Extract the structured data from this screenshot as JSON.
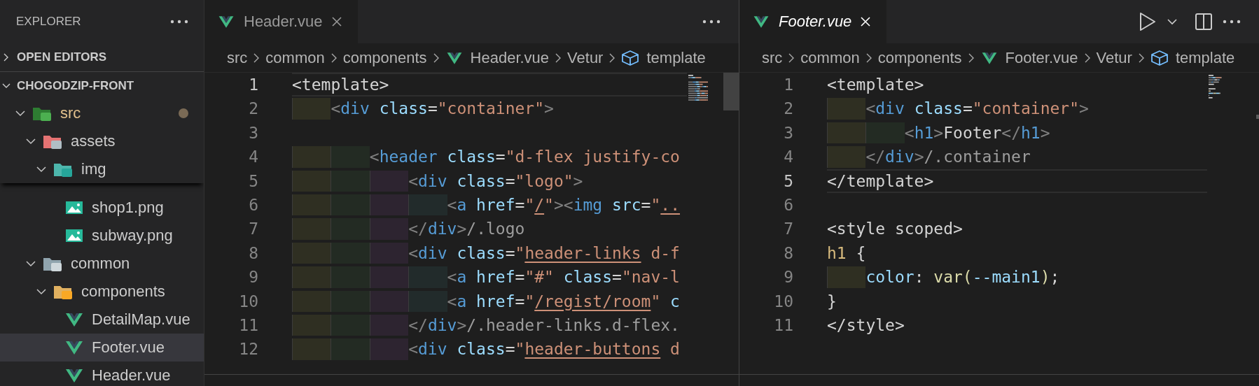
{
  "explorer": {
    "title": "EXPLORER",
    "sections": [
      {
        "label": "OPEN EDITORS",
        "expanded": false
      },
      {
        "label": "CHOGODZIP-FRONT",
        "expanded": true,
        "tree": [
          {
            "label": "src",
            "kind": "folder-code",
            "expanded": true,
            "modified": true,
            "children": [
              {
                "label": "assets",
                "kind": "folder-gear",
                "expanded": true,
                "modified": false,
                "children": [
                  {
                    "label": "img",
                    "kind": "folder-image",
                    "expanded": true,
                    "modified": false,
                    "children": [
                      {
                        "label": "shop1.png",
                        "kind": "image",
                        "selected": false,
                        "modified": false
                      },
                      {
                        "label": "subway.png",
                        "kind": "image",
                        "selected": false,
                        "modified": false
                      }
                    ]
                  }
                ]
              },
              {
                "label": "common",
                "kind": "folder-common",
                "expanded": true,
                "modified": false,
                "children": [
                  {
                    "label": "components",
                    "kind": "folder-lego",
                    "expanded": true,
                    "modified": false,
                    "children": [
                      {
                        "label": "DetailMap.vue",
                        "kind": "vue",
                        "selected": false,
                        "modified": false
                      },
                      {
                        "label": "Footer.vue",
                        "kind": "vue",
                        "selected": true,
                        "modified": false
                      },
                      {
                        "label": "Header.vue",
                        "kind": "vue",
                        "selected": false,
                        "modified": false
                      }
                    ]
                  }
                ]
              }
            ]
          }
        ]
      }
    ]
  },
  "editors": [
    {
      "focused": false,
      "tabs": [
        {
          "label": "Header.vue",
          "kind": "vue",
          "selected": true,
          "preview": false
        }
      ],
      "actions": [
        {
          "kind": "more"
        }
      ],
      "breadcrumbs": [
        {
          "kind": "plain",
          "label": "src"
        },
        {
          "kind": "plain",
          "label": "common"
        },
        {
          "kind": "plain",
          "label": "components"
        },
        {
          "kind": "vue",
          "label": "Header.vue"
        },
        {
          "kind": "plain",
          "label": "Vetur"
        },
        {
          "kind": "cube",
          "label": "template"
        }
      ],
      "lines": [
        {
          "n": "1",
          "current": true,
          "tokens": [
            {
              "kind": "text",
              "text": "<template>"
            }
          ]
        },
        {
          "n": "2",
          "current": false,
          "tokens": [
            {
              "kind": "punct",
              "text": "    <"
            },
            {
              "kind": "tag",
              "text": "div"
            },
            {
              "kind": "attr",
              "text": " class"
            },
            {
              "kind": "text",
              "text": "="
            },
            {
              "kind": "string",
              "text": "\"container\""
            },
            {
              "kind": "punct",
              "text": ">"
            }
          ]
        },
        {
          "n": "3",
          "current": false
        },
        {
          "n": "4",
          "current": false,
          "tokens": [
            {
              "kind": "punct",
              "text": "        <"
            },
            {
              "kind": "tag",
              "text": "header"
            },
            {
              "kind": "attr",
              "text": " class"
            },
            {
              "kind": "text",
              "text": "="
            },
            {
              "kind": "string",
              "text": "\"d-flex justify-co"
            }
          ]
        },
        {
          "n": "5",
          "current": false,
          "tokens": [
            {
              "kind": "punct",
              "text": "            <"
            },
            {
              "kind": "tag",
              "text": "div"
            },
            {
              "kind": "attr",
              "text": " class"
            },
            {
              "kind": "text",
              "text": "="
            },
            {
              "kind": "string",
              "text": "\"logo\""
            },
            {
              "kind": "punct",
              "text": ">"
            }
          ]
        },
        {
          "n": "6",
          "current": false,
          "tokens": [
            {
              "kind": "punct",
              "text": "                <"
            },
            {
              "kind": "tag",
              "text": "a"
            },
            {
              "kind": "attr",
              "text": " href"
            },
            {
              "kind": "text",
              "text": "="
            },
            {
              "kind": "string",
              "text": "\""
            },
            {
              "kind": "link",
              "text": "/"
            },
            {
              "kind": "string",
              "text": "\""
            },
            {
              "kind": "punct",
              "text": "><"
            },
            {
              "kind": "tag",
              "text": "img"
            },
            {
              "kind": "attr",
              "text": " src"
            },
            {
              "kind": "text",
              "text": "="
            },
            {
              "kind": "string",
              "text": "\""
            },
            {
              "kind": "link",
              "text": ".."
            }
          ]
        },
        {
          "n": "7",
          "current": false,
          "tokens": [
            {
              "kind": "punct",
              "text": "            </"
            },
            {
              "kind": "tag",
              "text": "div"
            },
            {
              "kind": "punct",
              "text": ">"
            },
            {
              "kind": "hint",
              "text": "/.logo"
            }
          ]
        },
        {
          "n": "8",
          "current": false,
          "tokens": [
            {
              "kind": "punct",
              "text": "            <"
            },
            {
              "kind": "tag",
              "text": "div"
            },
            {
              "kind": "attr",
              "text": " class"
            },
            {
              "kind": "text",
              "text": "="
            },
            {
              "kind": "string",
              "text": "\""
            },
            {
              "kind": "link",
              "text": "header-links"
            },
            {
              "kind": "string",
              "text": " d-f"
            }
          ]
        },
        {
          "n": "9",
          "current": false,
          "tokens": [
            {
              "kind": "punct",
              "text": "                <"
            },
            {
              "kind": "tag",
              "text": "a"
            },
            {
              "kind": "attr",
              "text": " href"
            },
            {
              "kind": "text",
              "text": "="
            },
            {
              "kind": "string",
              "text": "\"#\""
            },
            {
              "kind": "attr",
              "text": " class"
            },
            {
              "kind": "text",
              "text": "="
            },
            {
              "kind": "string",
              "text": "\"nav-l"
            }
          ]
        },
        {
          "n": "10",
          "current": false,
          "tokens": [
            {
              "kind": "punct",
              "text": "                <"
            },
            {
              "kind": "tag",
              "text": "a"
            },
            {
              "kind": "attr",
              "text": " href"
            },
            {
              "kind": "text",
              "text": "="
            },
            {
              "kind": "string",
              "text": "\""
            },
            {
              "kind": "link",
              "text": "/regist/room"
            },
            {
              "kind": "string",
              "text": "\""
            },
            {
              "kind": "attr",
              "text": " c"
            }
          ]
        },
        {
          "n": "11",
          "current": false,
          "tokens": [
            {
              "kind": "punct",
              "text": "            </"
            },
            {
              "kind": "tag",
              "text": "div"
            },
            {
              "kind": "punct",
              "text": ">"
            },
            {
              "kind": "hint",
              "text": "/.header-links.d-flex."
            }
          ]
        },
        {
          "n": "12",
          "current": false,
          "tokens": [
            {
              "kind": "punct",
              "text": "            <"
            },
            {
              "kind": "tag",
              "text": "div"
            },
            {
              "kind": "attr",
              "text": " class"
            },
            {
              "kind": "text",
              "text": "="
            },
            {
              "kind": "string",
              "text": "\""
            },
            {
              "kind": "link",
              "text": "header-buttons"
            },
            {
              "kind": "string",
              "text": " d"
            }
          ]
        }
      ]
    },
    {
      "focused": true,
      "tabs": [
        {
          "label": "Footer.vue",
          "kind": "vue",
          "selected": true,
          "preview": true
        }
      ],
      "actions": [
        {
          "kind": "run"
        },
        {
          "kind": "caret"
        },
        {
          "kind": "split"
        },
        {
          "kind": "more"
        }
      ],
      "breadcrumbs": [
        {
          "kind": "plain",
          "label": "src"
        },
        {
          "kind": "plain",
          "label": "common"
        },
        {
          "kind": "plain",
          "label": "components"
        },
        {
          "kind": "vue",
          "label": "Footer.vue"
        },
        {
          "kind": "plain",
          "label": "Vetur"
        },
        {
          "kind": "cube",
          "label": "template"
        }
      ],
      "lines": [
        {
          "n": "1",
          "current": false,
          "tokens": [
            {
              "kind": "text",
              "text": "<template>"
            }
          ]
        },
        {
          "n": "2",
          "current": false,
          "tokens": [
            {
              "kind": "punct",
              "text": "    <"
            },
            {
              "kind": "tag",
              "text": "div"
            },
            {
              "kind": "attr",
              "text": " class"
            },
            {
              "kind": "text",
              "text": "="
            },
            {
              "kind": "string",
              "text": "\"container\""
            },
            {
              "kind": "punct",
              "text": ">"
            }
          ]
        },
        {
          "n": "3",
          "current": false,
          "tokens": [
            {
              "kind": "punct",
              "text": "        <"
            },
            {
              "kind": "tag",
              "text": "h1"
            },
            {
              "kind": "punct",
              "text": ">"
            },
            {
              "kind": "text",
              "text": "Footer"
            },
            {
              "kind": "punct",
              "text": "</"
            },
            {
              "kind": "tag",
              "text": "h1"
            },
            {
              "kind": "punct",
              "text": ">"
            }
          ]
        },
        {
          "n": "4",
          "current": false,
          "tokens": [
            {
              "kind": "punct",
              "text": "    </"
            },
            {
              "kind": "tag",
              "text": "div"
            },
            {
              "kind": "punct",
              "text": ">"
            },
            {
              "kind": "hint",
              "text": "/.container"
            }
          ]
        },
        {
          "n": "5",
          "current": true,
          "tokens": [
            {
              "kind": "text",
              "text": "</template>"
            }
          ]
        },
        {
          "n": "6",
          "current": false
        },
        {
          "n": "7",
          "current": false,
          "tokens": [
            {
              "kind": "text",
              "text": "<style scoped>"
            }
          ]
        },
        {
          "n": "8",
          "current": false,
          "tokens": [
            {
              "kind": "selector",
              "text": "h1"
            },
            {
              "kind": "text",
              "text": " {"
            }
          ]
        },
        {
          "n": "9",
          "current": false,
          "tokens": [
            {
              "kind": "prop",
              "text": "    color"
            },
            {
              "kind": "text",
              "text": ": "
            },
            {
              "kind": "func",
              "text": "var("
            },
            {
              "kind": "prop",
              "text": "--main1"
            },
            {
              "kind": "func",
              "text": ")"
            },
            {
              "kind": "text",
              "text": ";"
            }
          ]
        },
        {
          "n": "10",
          "current": false,
          "tokens": [
            {
              "kind": "text",
              "text": "}"
            }
          ]
        },
        {
          "n": "11",
          "current": false,
          "tokens": [
            {
              "kind": "text",
              "text": "</style>"
            }
          ]
        }
      ]
    }
  ]
}
